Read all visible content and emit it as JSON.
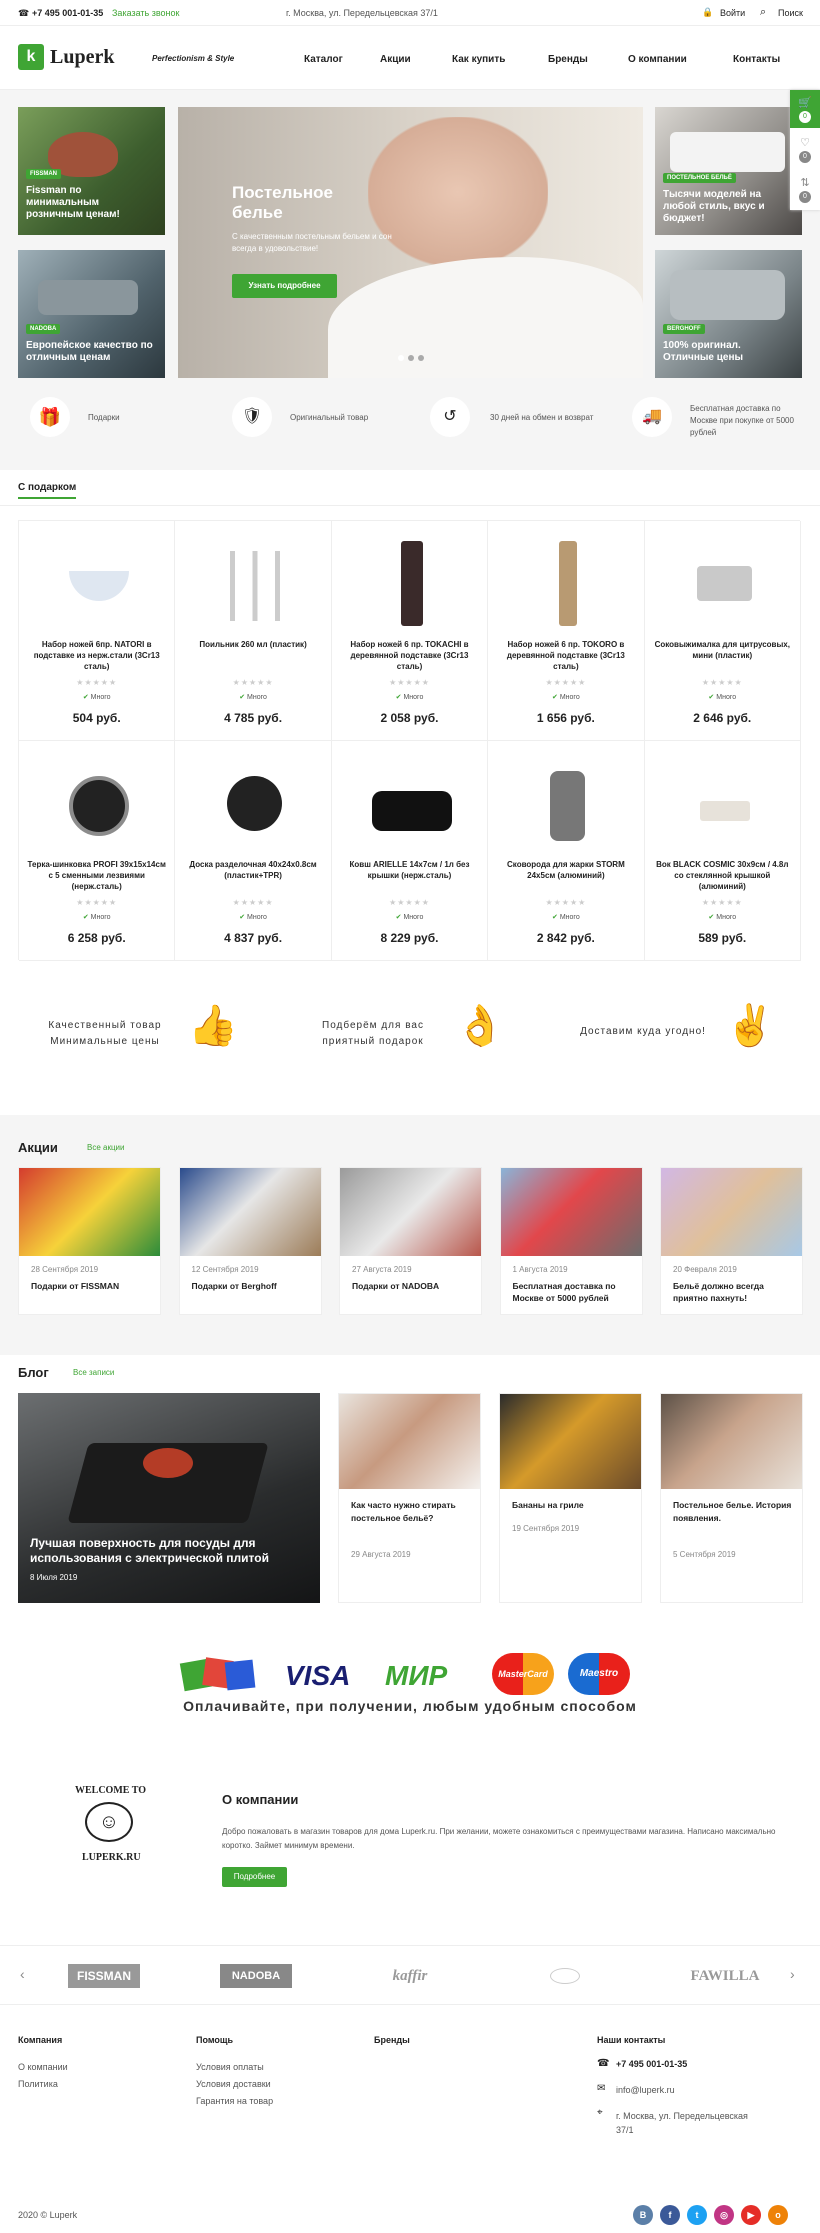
{
  "topbar": {
    "phone": "+7 495 001-01-35",
    "callback": "Заказать звонок",
    "address": "г. Москва, ул. Передельцевская 37/1",
    "login": "Войти",
    "search": "Поиск"
  },
  "header": {
    "logo_letter": "k",
    "logo_text": "Luperk",
    "tagline": "Perfectionism & Style",
    "nav": [
      "Каталог",
      "Акции",
      "Как купить",
      "Бренды",
      "О компании",
      "Контакты"
    ]
  },
  "side_widget": {
    "cart_count": "0",
    "fav_count": "0",
    "compare_count": "0"
  },
  "hero": {
    "left_top": {
      "label": "FISSMAN",
      "title": "Fissman по минимальным розничным ценам!"
    },
    "left_bottom": {
      "label": "NADOBA",
      "title": "Европейское качество по отличным ценам"
    },
    "center": {
      "title": "Постельное белье",
      "subtitle": "С качественным постельным бельем и сон всегда в удовольствие!",
      "button": "Узнать подробнее"
    },
    "right_top": {
      "label": "ПОСТЕЛЬНОЕ БЕЛЬЁ",
      "title": "Тысячи моделей на любой стиль, вкус и бюджет!"
    },
    "right_bottom": {
      "label": "BERGHOFF",
      "title": "100% оригинал. Отличные цены"
    }
  },
  "features": [
    "Подарки",
    "Оригинальный товар",
    "30 дней на обмен и возврат",
    "Бесплатная доставка по Москве при покупке от 5000 рублей"
  ],
  "gifts": {
    "title": "С подарком",
    "stock": "Много",
    "products": [
      {
        "name": "Набор ножей 6пр. NATORI в подставке из нерж.стали (3Cr13 сталь)",
        "price": "504 руб."
      },
      {
        "name": "Поильник 260 мл (пластик)",
        "price": "4 785 руб."
      },
      {
        "name": "Набор ножей 6 пр. TOKACHI в деревянной подставке (3Cr13 сталь)",
        "price": "2 058 руб."
      },
      {
        "name": "Набор ножей 6 пр. TOKORO в деревянной подставке (3Cr13 сталь)",
        "price": "1 656 руб."
      },
      {
        "name": "Соковыжималка для цитрусовых, мини (пластик)",
        "price": "2 646 руб."
      },
      {
        "name": "Терка-шинковка PROFI 39х15х14см с 5 сменными лезвиями (нерж.сталь)",
        "price": "6 258 руб."
      },
      {
        "name": "Доска разделочная 40х24х0.8см (пластик+TPR)",
        "price": "4 837 руб."
      },
      {
        "name": "Ковш ARIELLE 14х7см / 1л без крышки (нерж.сталь)",
        "price": "8 229 руб."
      },
      {
        "name": "Сковорода для жарки STORM 24х5см (алюминий)",
        "price": "2 842 руб."
      },
      {
        "name": "Вок BLACK COSMIC 30х9см / 4.8л со стеклянной крышкой (алюминий)",
        "price": "589 руб."
      }
    ]
  },
  "benefits": [
    {
      "l1": "Качественный товар",
      "l2": "Минимальные цены"
    },
    {
      "l1": "Подберём для вас",
      "l2": "приятный подарок"
    },
    {
      "l1": "Доставим куда угодно!",
      "l2": ""
    }
  ],
  "promos": {
    "title": "Акции",
    "all": "Все акции",
    "items": [
      {
        "date": "28 Сентября 2019",
        "title": "Подарки от FISSMAN"
      },
      {
        "date": "12 Сентября 2019",
        "title": "Подарки от Berghoff"
      },
      {
        "date": "27 Августа 2019",
        "title": "Подарки от NADOBA"
      },
      {
        "date": "1 Августа 2019",
        "title": "Бесплатная доставка по Москве от 5000 рублей"
      },
      {
        "date": "20 Февраля 2019",
        "title": "Бельё должно всегда приятно пахнуть!"
      }
    ]
  },
  "blog": {
    "title": "Блог",
    "all": "Все записи",
    "featured": {
      "title": "Лучшая поверхность для посуды для использования с электрической плитой",
      "date": "8 Июля 2019"
    },
    "items": [
      {
        "title": "Как часто нужно стирать постельное бельё?",
        "date": "29 Августа 2019"
      },
      {
        "title": "Бананы на гриле",
        "date": "19 Сентября 2019"
      },
      {
        "title": "Постельное белье. История появления.",
        "date": "5 Сентября 2019"
      }
    ]
  },
  "payment": {
    "caption": "Оплачивайте, при получении, любым удобным способом",
    "logos": [
      "VISA",
      "МИР",
      "MasterCard",
      "Maestro"
    ]
  },
  "about": {
    "welcome": "WELCOME TO",
    "site": "LUPERK.RU",
    "title": "О компании",
    "text": "Добро пожаловать в магазин товаров для дома Luperk.ru. При желании, можете ознакомиться с преимуществами магазина. Написано максимально коротко. Займет минимум времени.",
    "button": "Подробнее"
  },
  "brands": [
    "FISSMAN",
    "NADOBA",
    "kaffir",
    "",
    "FAWILLA"
  ],
  "footer": {
    "col1": {
      "title": "Компания",
      "links": [
        "О компании",
        "Политика"
      ]
    },
    "col2": {
      "title": "Помощь",
      "links": [
        "Условия оплаты",
        "Условия доставки",
        "Гарантия на товар"
      ]
    },
    "col3": {
      "title": "Бренды"
    },
    "contacts": {
      "title": "Наши контакты",
      "phone": "+7 495 001-01-35",
      "email": "info@luperk.ru",
      "address": "г. Москва, ул. Передельцевская 37/1"
    },
    "copyright": "2020 © Luperk",
    "social": [
      "В",
      "f",
      "t",
      "◎",
      "▶",
      "о"
    ]
  },
  "colors": {
    "accent": "#3fa534"
  }
}
